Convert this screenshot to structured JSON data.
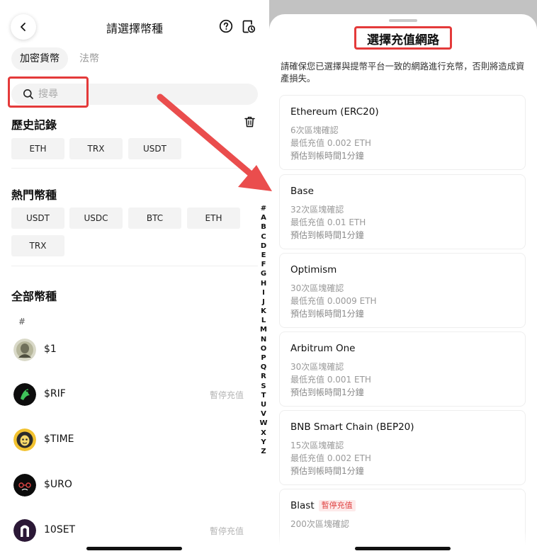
{
  "left": {
    "title": "請選擇幣種",
    "tabs": {
      "crypto": "加密貨幣",
      "fiat": "法幣"
    },
    "search_placeholder": "搜尋",
    "history": {
      "title": "歷史記錄",
      "chips": [
        "ETH",
        "TRX",
        "USDT"
      ]
    },
    "hot": {
      "title": "熱門幣種",
      "chips": [
        "USDT",
        "USDC",
        "BTC",
        "ETH",
        "TRX"
      ]
    },
    "all": {
      "title": "全部幣種",
      "group_label": "#",
      "coins": [
        {
          "name": "$1",
          "status": ""
        },
        {
          "name": "$RIF",
          "status": "暫停充值"
        },
        {
          "name": "$TIME",
          "status": ""
        },
        {
          "name": "$URO",
          "status": ""
        },
        {
          "name": "10SET",
          "status": "暫停充值"
        }
      ]
    },
    "alpha_index": [
      "#",
      "A",
      "B",
      "C",
      "D",
      "E",
      "F",
      "G",
      "H",
      "I",
      "J",
      "K",
      "L",
      "M",
      "N",
      "O",
      "P",
      "Q",
      "R",
      "S",
      "T",
      "U",
      "V",
      "W",
      "X",
      "Y",
      "Z"
    ]
  },
  "right": {
    "title": "選擇充值網路",
    "notice": "請確保您已選擇與提幣平台一致的網路進行充幣，否則將造成資產損失。",
    "networks": [
      {
        "name": "Ethereum (ERC20)",
        "badge": "",
        "confirm": "6次區塊確認",
        "min": "最低充值 0.002 ETH",
        "eta": "預估到帳時間1分鐘"
      },
      {
        "name": "Base",
        "badge": "",
        "confirm": "32次區塊確認",
        "min": "最低充值 0.01 ETH",
        "eta": "預估到帳時間1分鐘"
      },
      {
        "name": "Optimism",
        "badge": "",
        "confirm": "30次區塊確認",
        "min": "最低充值 0.0009 ETH",
        "eta": "預估到帳時間1分鐘"
      },
      {
        "name": "Arbitrum One",
        "badge": "",
        "confirm": "30次區塊確認",
        "min": "最低充值 0.001 ETH",
        "eta": "預估到帳時間1分鐘"
      },
      {
        "name": "BNB Smart Chain (BEP20)",
        "badge": "",
        "confirm": "15次區塊確認",
        "min": "最低充值 0.002 ETH",
        "eta": "預估到帳時間1分鐘"
      },
      {
        "name": "Blast",
        "badge": "暫停充值",
        "confirm": "200次區塊確認",
        "min": "",
        "eta": ""
      }
    ]
  },
  "colors": {
    "highlight": "#e43a3a",
    "arrow": "#ea4d4d",
    "chip_bg": "#f3f3f3",
    "muted_text": "#9a9a9a",
    "suspend_text": "#e04545"
  }
}
